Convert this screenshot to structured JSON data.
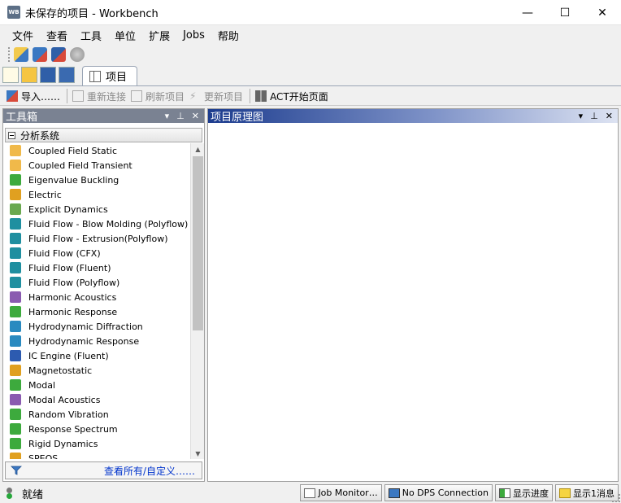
{
  "window": {
    "app_icon_text": "WB",
    "title": "未保存的项目 - Workbench",
    "minimize": "—",
    "maximize": "☐",
    "close": "✕"
  },
  "menu": {
    "items": [
      "文件",
      "查看",
      "工具",
      "单位",
      "扩展",
      "Jobs",
      "帮助"
    ]
  },
  "toolbar": {
    "tab_label": "项目",
    "import_label": "导入……",
    "reconnect_label": "重新连接",
    "refresh_label": "刷新项目",
    "update_label": "更新项目",
    "act_label": "ACT开始页面"
  },
  "toolbox": {
    "title": "工具箱",
    "pin": "⊼",
    "pin2": "ᛜ",
    "close": "✕",
    "group_label": "分析系统",
    "view_all_label": "查看所有/自定义……",
    "items": [
      {
        "label": "Coupled Field Static",
        "icon": "coupled-field-icon",
        "color": "#f0b94a"
      },
      {
        "label": "Coupled Field Transient",
        "icon": "coupled-field-icon",
        "color": "#f0b94a"
      },
      {
        "label": "Eigenvalue Buckling",
        "icon": "buckling-icon",
        "color": "#3daa3d"
      },
      {
        "label": "Electric",
        "icon": "electric-icon",
        "color": "#e0a020"
      },
      {
        "label": "Explicit Dynamics",
        "icon": "explicit-icon",
        "color": "#6aa84f"
      },
      {
        "label": "Fluid Flow - Blow Molding (Polyflow)",
        "icon": "fluid-icon",
        "color": "#1f8fa0"
      },
      {
        "label": "Fluid Flow - Extrusion(Polyflow)",
        "icon": "fluid-icon",
        "color": "#1f8fa0"
      },
      {
        "label": "Fluid Flow (CFX)",
        "icon": "fluid-icon",
        "color": "#1f8fa0"
      },
      {
        "label": "Fluid Flow (Fluent)",
        "icon": "fluid-icon",
        "color": "#1f8fa0"
      },
      {
        "label": "Fluid Flow (Polyflow)",
        "icon": "fluid-icon",
        "color": "#1f8fa0"
      },
      {
        "label": "Harmonic Acoustics",
        "icon": "acoustics-icon",
        "color": "#8a5bb0"
      },
      {
        "label": "Harmonic Response",
        "icon": "harmonic-icon",
        "color": "#3daa3d"
      },
      {
        "label": "Hydrodynamic Diffraction",
        "icon": "hydro-icon",
        "color": "#2a8ac0"
      },
      {
        "label": "Hydrodynamic Response",
        "icon": "hydro-icon",
        "color": "#2a8ac0"
      },
      {
        "label": "IC Engine (Fluent)",
        "icon": "engine-icon",
        "color": "#2d5bb0"
      },
      {
        "label": "Magnetostatic",
        "icon": "magnet-icon",
        "color": "#e0a020"
      },
      {
        "label": "Modal",
        "icon": "modal-icon",
        "color": "#3daa3d"
      },
      {
        "label": "Modal Acoustics",
        "icon": "acoustics-icon",
        "color": "#8a5bb0"
      },
      {
        "label": "Random Vibration",
        "icon": "random-icon",
        "color": "#3daa3d"
      },
      {
        "label": "Response Spectrum",
        "icon": "spectrum-icon",
        "color": "#3daa3d"
      },
      {
        "label": "Rigid Dynamics",
        "icon": "rigid-icon",
        "color": "#3daa3d"
      },
      {
        "label": "SPEOS",
        "icon": "speos-icon",
        "color": "#e0a020"
      }
    ]
  },
  "schematic": {
    "title": "项目原理图"
  },
  "status": {
    "text": "就绪",
    "job_monitor": "Job Monitor…",
    "dps": "No DPS Connection",
    "progress": "显示进度",
    "messages": "显示1消息"
  }
}
